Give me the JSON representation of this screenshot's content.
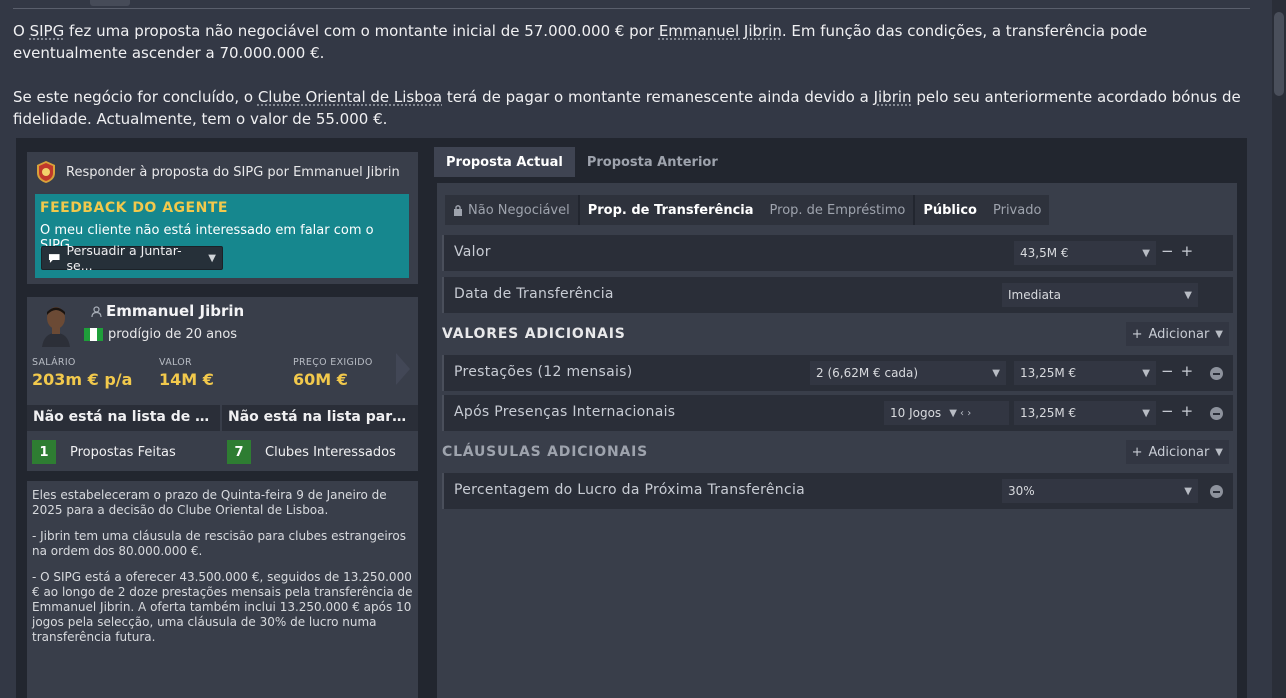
{
  "message": {
    "p1": [
      "O ",
      "SIPG",
      " fez uma proposta não negociável com o montante inicial de 57.000.000 € por ",
      "Emmanuel Jibrin",
      ". Em função das condições, a transferência pode eventualmente ascender a 70.000.000 €."
    ],
    "p2": [
      "Se este negócio for concluído, o ",
      "Clube Oriental de Lisboa",
      " terá de pagar o montante remanescente ainda devido a ",
      "Jibrin",
      " pelo seu anteriormente acordado bónus de fidelidade. Actualmente, tem o valor de 55.000 €."
    ]
  },
  "respond": {
    "title": "Responder à proposta do SIPG por Emmanuel Jibrin",
    "feedback_title": "FEEDBACK DO AGENTE",
    "feedback_text": "O meu cliente não está interessado em falar com o SIPG.",
    "action_select": "Persuadir a Juntar-se..."
  },
  "player": {
    "name": "Emmanuel Jibrin",
    "description": "prodígio de 20 anos",
    "stats": [
      {
        "label": "SALÁRIO",
        "value": "203m € p/a"
      },
      {
        "label": "VALOR",
        "value": "14M €"
      },
      {
        "label": "PREÇO EXIGIDO",
        "value": "60M €"
      }
    ],
    "list_status": [
      "Não está na lista de transferências",
      "Não está na lista para empréstimo"
    ],
    "counts": [
      {
        "num": "1",
        "label": "Propostas Feitas"
      },
      {
        "num": "7",
        "label": "Clubes Interessados"
      }
    ]
  },
  "notes": [
    "Eles estabeleceram o prazo de Quinta-feira 9 de Janeiro de 2025 para a decisão do Clube Oriental de Lisboa.",
    "- Jibrin tem uma cláusula de rescisão para clubes estrangeiros na ordem dos 80.000.000 €.",
    "- O SIPG está a oferecer 43.500.000 €, seguidos de 13.250.000 € ao longo de 2 doze prestações mensais pela transferência de Emmanuel Jibrin. A oferta também inclui 13.250.000 € após 10 jogos pela selecção, uma cláusula de 30% de lucro numa transferência futura."
  ],
  "tabs": [
    "Proposta Actual",
    "Proposta Anterior"
  ],
  "chips": {
    "non_negotiable": "Não Negociável",
    "transfer": "Prop. de Transferência",
    "loan": "Prop. de Empréstimo",
    "public": "Público",
    "private": "Privado"
  },
  "offer": {
    "value_label": "Valor",
    "value": "43,5M €",
    "date_label": "Data de Transferência",
    "date_value": "Imediata",
    "additional_title": "VALORES ADICIONAIS",
    "add_label": "Adicionar",
    "installments_label": "Prestações (12 mensais)",
    "installments_select": "2 (6,62M € cada)",
    "installments_value": "13,25M €",
    "intl_label": "Após Presenças Internacionais",
    "intl_select": "10 Jogos",
    "intl_value": "13,25M €",
    "clauses_title": "CLÁUSULAS ADICIONAIS",
    "sell_on_label": "Percentagem do Lucro da Próxima Transferência",
    "sell_on_value": "30%"
  }
}
